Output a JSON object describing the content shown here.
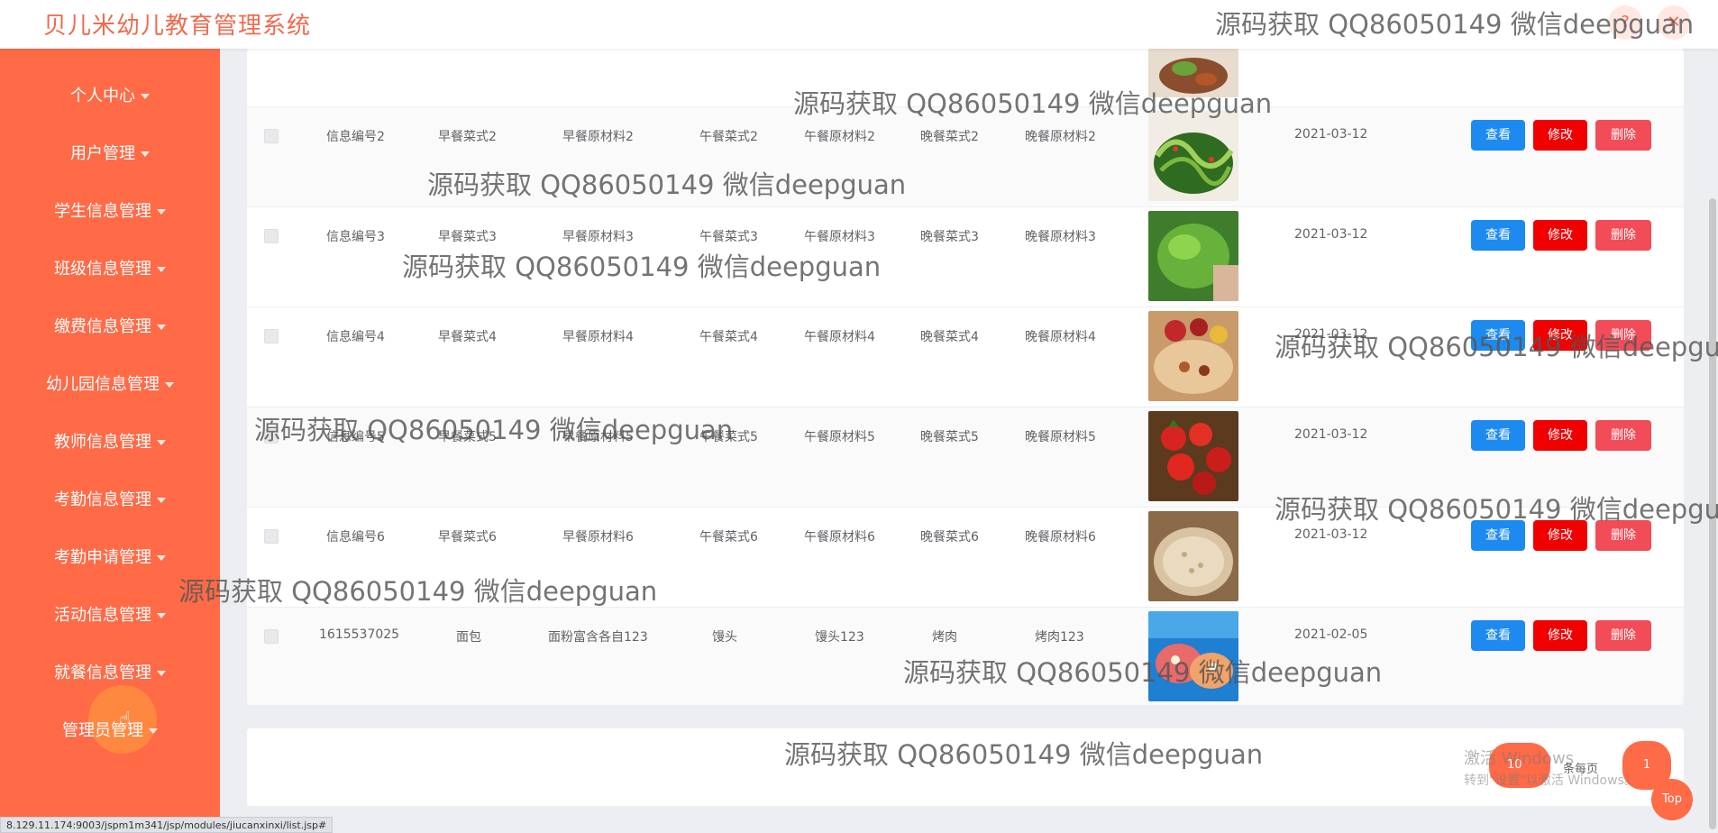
{
  "app": {
    "title": "贝儿米幼儿教育管理系统"
  },
  "header": {
    "icons": [
      "question-icon",
      "close-icon"
    ]
  },
  "sidebar": {
    "items": [
      {
        "label": "个人中心"
      },
      {
        "label": "用户管理"
      },
      {
        "label": "学生信息管理"
      },
      {
        "label": "班级信息管理"
      },
      {
        "label": "缴费信息管理"
      },
      {
        "label": "幼儿园信息管理"
      },
      {
        "label": "教师信息管理"
      },
      {
        "label": "考勤信息管理"
      },
      {
        "label": "考勤申请管理"
      },
      {
        "label": "活动信息管理"
      },
      {
        "label": "就餐信息管理"
      },
      {
        "label": "管理员管理"
      }
    ]
  },
  "table": {
    "actions": {
      "view": "查看",
      "edit": "修改",
      "delete": "删除"
    },
    "rows": [
      {
        "id": "信息编号2",
        "breakfast": "早餐菜式2",
        "breakfast_material": "早餐原材料2",
        "lunch": "午餐菜式2",
        "lunch_material": "午餐原材料2",
        "dinner": "晚餐菜式2",
        "dinner_material": "晚餐原材料2",
        "date": "2021-03-12"
      },
      {
        "id": "信息编号3",
        "breakfast": "早餐菜式3",
        "breakfast_material": "早餐原材料3",
        "lunch": "午餐菜式3",
        "lunch_material": "午餐原材料3",
        "dinner": "晚餐菜式3",
        "dinner_material": "晚餐原材料3",
        "date": "2021-03-12"
      },
      {
        "id": "信息编号4",
        "breakfast": "早餐菜式4",
        "breakfast_material": "早餐原材料4",
        "lunch": "午餐菜式4",
        "lunch_material": "午餐原材料4",
        "dinner": "晚餐菜式4",
        "dinner_material": "晚餐原材料4",
        "date": "2021-03-12"
      },
      {
        "id": "信息编号5",
        "breakfast": "早餐菜式5",
        "breakfast_material": "早餐原材料5",
        "lunch": "午餐菜式5",
        "lunch_material": "午餐原材料5",
        "dinner": "晚餐菜式5",
        "dinner_material": "晚餐原材料5",
        "date": "2021-03-12"
      },
      {
        "id": "信息编号6",
        "breakfast": "早餐菜式6",
        "breakfast_material": "早餐原材料6",
        "lunch": "午餐菜式6",
        "lunch_material": "午餐原材料6",
        "dinner": "晚餐菜式6",
        "dinner_material": "晚餐原材料6",
        "date": "2021-03-12"
      },
      {
        "id": "1615537025",
        "breakfast": "面包",
        "breakfast_material": "面粉富含各自123",
        "lunch": "馒头",
        "lunch_material": "馒头123",
        "dinner": "烤肉",
        "dinner_material": "烤肉123",
        "date": "2021-02-05"
      }
    ]
  },
  "pagination": {
    "page_size": "10",
    "page_size_label": "条每页",
    "current_page": "1"
  },
  "back_to_top": "Top",
  "windows_activation": {
    "line1": "激活 Windows",
    "line2": "转到\"设置\"以激活 Windows。"
  },
  "status_bar": {
    "url": "8.129.11.174:9003/jspm1m341/jsp/modules/jiucanxinxi/list.jsp#"
  },
  "watermark": {
    "text": "源码获取 QQ86050149 微信deepguan"
  },
  "colors": {
    "brand": "#ef6b4f",
    "sidebar": "#ff6a47",
    "view": "#1d8af0",
    "edit": "#f00000",
    "delete": "#f24c58"
  }
}
